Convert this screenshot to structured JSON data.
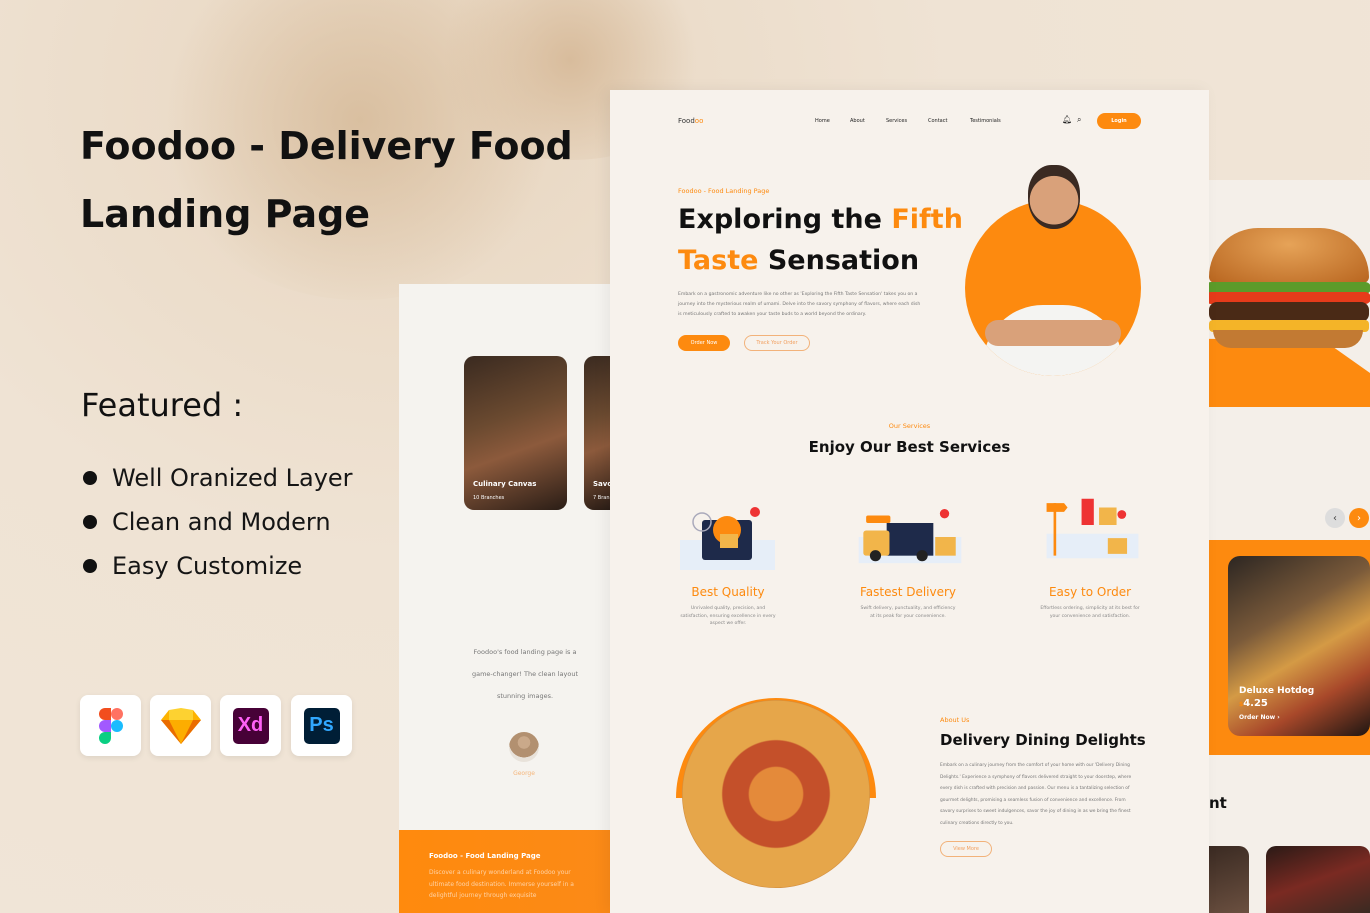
{
  "promo": {
    "title": "Foodoo - Delivery Food Landing Page",
    "featured_heading": "Featured :",
    "features": [
      "Well Oranized Layer",
      "Clean and Modern",
      "Easy Customize"
    ],
    "tools": [
      {
        "icon": "figma-icon"
      },
      {
        "icon": "sketch-icon"
      },
      {
        "icon": "xd-icon",
        "label": "Xd"
      },
      {
        "icon": "photoshop-icon",
        "label": "Ps"
      }
    ]
  },
  "accent": "#fd8a0f",
  "left_page": {
    "cards": [
      {
        "name": "Culinary Canvas",
        "branches": "10 Branches"
      },
      {
        "name": "Savo",
        "branches": "7 Bran"
      }
    ],
    "testimonial": [
      "Foodoo's food landing page is a",
      "game-changer! The clean layout",
      "stunning  images."
    ],
    "reviewer": "George",
    "footer_title": "Foodoo -  Food Landing Page",
    "footer_text": "Discover a culinary wonderland at Foodoo  your ultimate food  destination. Immerse yourself in a delightful journey through exquisite"
  },
  "main_page": {
    "logo": {
      "a": "Food",
      "b": "oo"
    },
    "nav": [
      "Home",
      "About",
      "Services",
      "Contact",
      "Testimonials"
    ],
    "login": "Login",
    "hero": {
      "tag": "Foodoo -  Food Landing Page",
      "line1a": "Exploring the ",
      "line1b": "Fifth",
      "line2a": "Taste ",
      "line2b": "Sensation",
      "text": "Embark on a gastronomic adventure like no other as 'Exploring the Fifth  Taste Sensation' takes you on a journey into the mysterious realm of  umami. Delve into the savory symphony of flavors, where each dish is  meticulously crafted to awaken your taste buds to a world beyond the  ordinary.",
      "order_btn": "Order Now",
      "track_btn": "Track Your Order"
    },
    "services": {
      "tag": "Our Services",
      "heading": "Enjoy Our Best Services",
      "items": [
        {
          "title": "Best Quality",
          "desc": "Unrivaled quality, precision, and satisfaction, ensuring excellence in every aspect we offer."
        },
        {
          "title": "Fastest Delivery",
          "desc": "Swift delivery, punctuality, and efficiency at its peak for your convenience."
        },
        {
          "title": "Easy to Order",
          "desc": "Effortless ordering, simplicity at its best for your convenience and satisfaction."
        }
      ]
    },
    "about": {
      "tag": "About Us",
      "heading": "Delivery Dining Delights",
      "text": "Embark on a culinary journey from the comfort of your home with our 'Delivery Dining Delights.' Experience a symphony of flavors delivered straight to your doorstep, where every dish is crafted with precision and passion. Our menu is a tantalizing selection of gourmet delights, promising a seamless fusion of convenience and excellence. From savory surprises to sweet indulgences, savor the joy of dining in as we bring the finest culinary creations directly to you.",
      "button": "View More"
    }
  },
  "right_page": {
    "prev": "‹",
    "next": "›",
    "item": {
      "name": "Deluxe Hotdog",
      "currency": "$",
      "price": "4.25",
      "order": "Order Now"
    },
    "heading_fragment": "nt"
  }
}
